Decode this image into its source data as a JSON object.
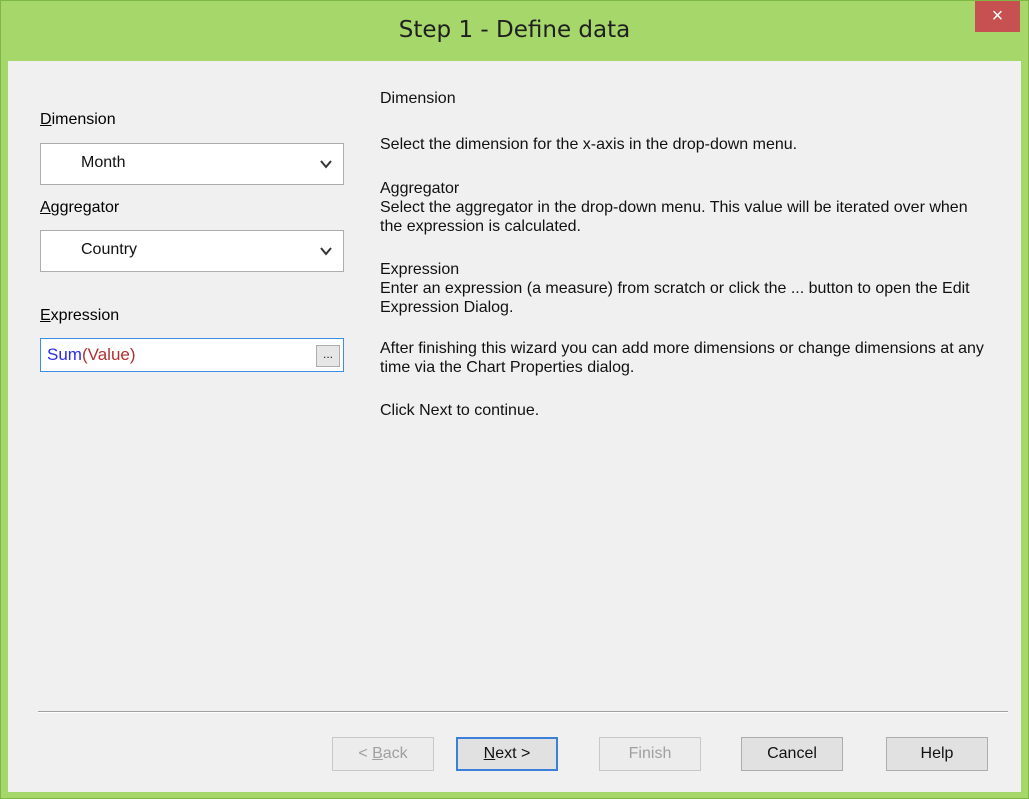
{
  "window": {
    "title": "Step 1 - Define data",
    "close_label": "×",
    "accent": "#a6d76a"
  },
  "fields": {
    "dimension": {
      "label_accel": "D",
      "label_rest": "imension",
      "value": "Month"
    },
    "aggregator": {
      "label_accel": "A",
      "label_rest": "ggregator",
      "value": "Country"
    },
    "expression": {
      "label_accel": "E",
      "label_rest": "xpression",
      "fn": "Sum",
      "open": "(",
      "arg": "Value",
      "close": ")",
      "ellipsis_label": "..."
    }
  },
  "help": {
    "heading": "Dimension",
    "dimension_text": "Select the dimension for the x-axis in the drop-down menu.",
    "aggregator_title": "Aggregator",
    "aggregator_text": "Select the aggregator in the drop-down menu. This value will be iterated over when the expression is calculated.",
    "expression_title": "Expression",
    "expression_text": "Enter an expression (a measure) from scratch or click the ... button to open the Edit Expression Dialog.",
    "after_text": "After finishing this wizard you can add more dimensions or change dimensions at any time via the Chart Properties dialog.",
    "continue_text": "Click Next to continue."
  },
  "buttons": {
    "back_pre": "< ",
    "back_accel": "B",
    "back_rest": "ack",
    "next_accel": "N",
    "next_rest": "ext >",
    "finish": "Finish",
    "cancel": "Cancel",
    "help": "Help"
  }
}
